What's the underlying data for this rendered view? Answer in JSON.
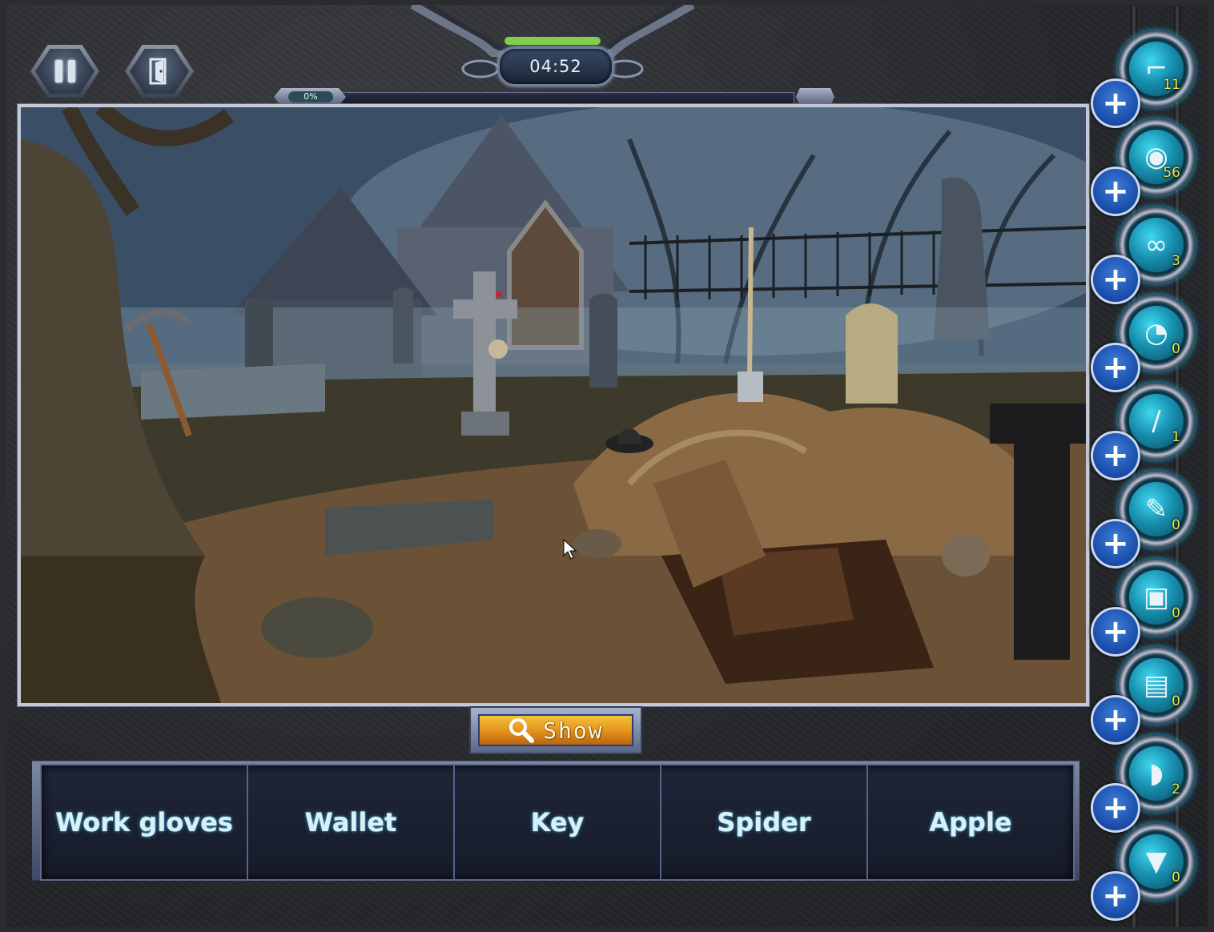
{
  "hud": {
    "pause_icon": "pause-icon",
    "exit_icon": "exit-door-icon",
    "timer": "04:52",
    "progress_label": "0%",
    "progress_value": 0
  },
  "show_button": {
    "label": "Show",
    "icon": "magnifier-icon"
  },
  "items_to_find": [
    "Work gloves",
    "Wallet",
    "Key",
    "Spider",
    "Apple"
  ],
  "tools": [
    {
      "icon": "scanner-icon",
      "count": "11"
    },
    {
      "icon": "camera-robot-icon",
      "count": "56"
    },
    {
      "icon": "night-goggles-icon",
      "count": "3"
    },
    {
      "icon": "stopwatch-icon",
      "count": "0"
    },
    {
      "icon": "wand-icon",
      "count": "1"
    },
    {
      "icon": "pen-laser-icon",
      "count": "0"
    },
    {
      "icon": "safe-box-icon",
      "count": "0"
    },
    {
      "icon": "device-icon",
      "count": "0"
    },
    {
      "icon": "flashlight-icon",
      "count": "2"
    },
    {
      "icon": "torch-icon",
      "count": "0"
    }
  ],
  "colors": {
    "accent": "#2fb8d8",
    "button_gold": "#f4c23a",
    "panel": "#1f2638"
  }
}
